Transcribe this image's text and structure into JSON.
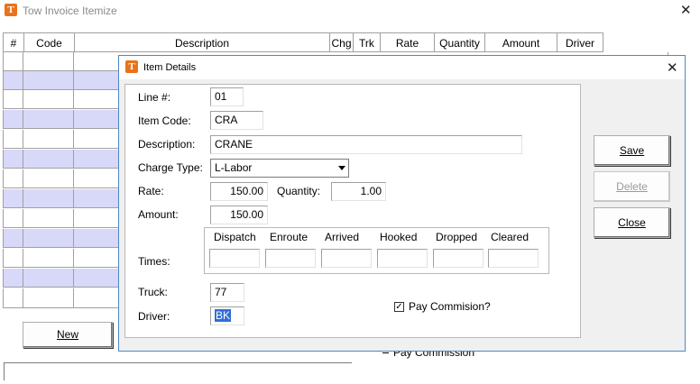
{
  "window": {
    "title": "Tow Invoice Itemize",
    "icon_letter": "T"
  },
  "grid": {
    "headers": [
      "#",
      "Code",
      "Description",
      "Chg",
      "Trk",
      "Rate",
      "Quantity",
      "Amount",
      "Driver"
    ]
  },
  "buttons": {
    "new": "New"
  },
  "pay_commission_bg": "Pay Commission",
  "dialog": {
    "title": "Item Details",
    "icon_letter": "T",
    "labels": {
      "line": "Line #:",
      "item_code": "Item Code:",
      "description": "Description:",
      "charge_type": "Charge Type:",
      "rate": "Rate:",
      "quantity": "Quantity:",
      "amount": "Amount:",
      "times": "Times:",
      "truck": "Truck:",
      "driver": "Driver:"
    },
    "values": {
      "line": "01",
      "item_code": "CRA",
      "description": "CRANE",
      "charge_type": "L-Labor",
      "rate": "150.00",
      "quantity": "1.00",
      "amount": "150.00",
      "truck": "77",
      "driver": "BK"
    },
    "times": [
      "Dispatch",
      "Enroute",
      "Arrived",
      "Hooked",
      "Dropped",
      "Cleared"
    ],
    "pay_commission": {
      "label": "Pay Commision?",
      "checked": true
    },
    "buttons": {
      "save": "Save",
      "delete": "Delete",
      "close": "Close"
    }
  },
  "colors": {
    "alt_row": "#d8d8f8",
    "dialog_border": "#4f86c6",
    "selection": "#2f6fd6",
    "icon_orange": "#e8731a"
  }
}
